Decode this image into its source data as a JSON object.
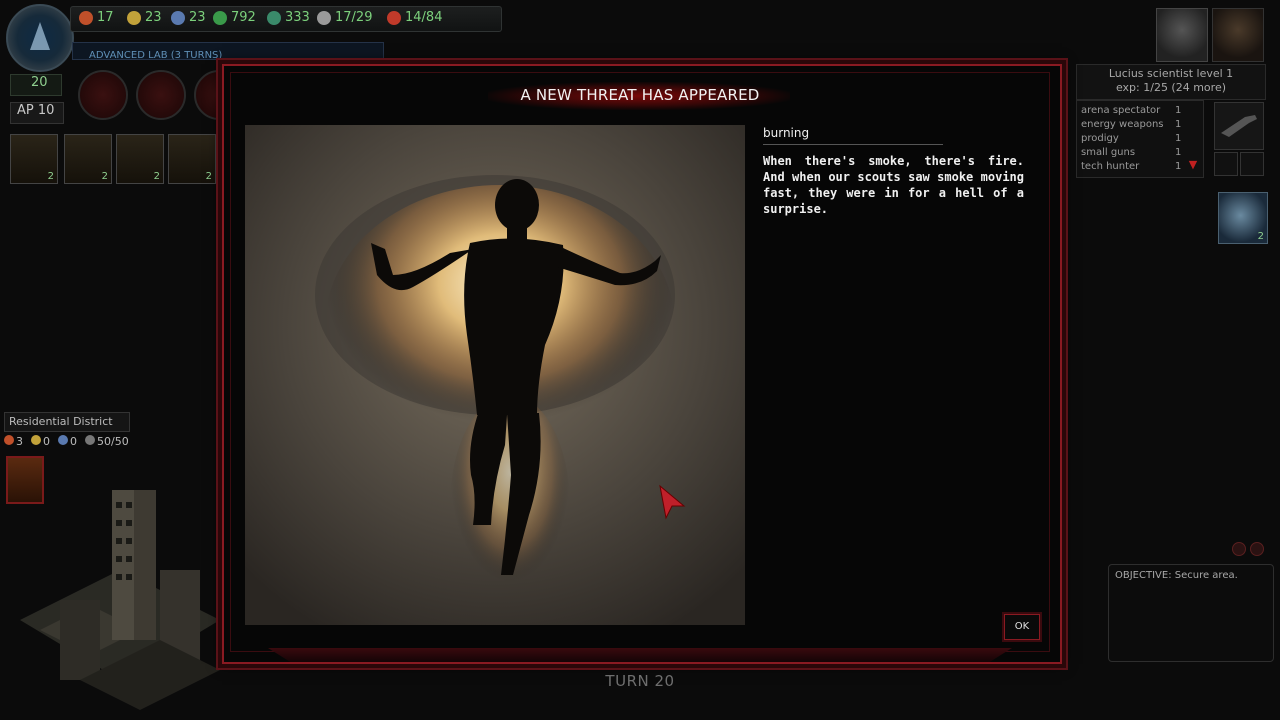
{
  "colors": {
    "accent_red": "#8a1a22",
    "resource_green": "#7cd07c",
    "lab_blue": "#5f8fb6"
  },
  "resources": [
    {
      "icon": "flame-icon",
      "value": "17",
      "color": "#c0502a"
    },
    {
      "icon": "coin-icon",
      "value": "23",
      "color": "#c2a23a"
    },
    {
      "icon": "energy-icon",
      "value": "23",
      "color": "#5a7ab0"
    },
    {
      "icon": "money-icon",
      "value": "792",
      "color": "#3a9a4a"
    },
    {
      "icon": "influence-icon",
      "value": "333",
      "color": "#3a8a6a"
    },
    {
      "icon": "radiation-icon",
      "value": "17/29",
      "color": "#9a9a9a"
    },
    {
      "icon": "unit-icon",
      "value": "14/84",
      "color": "#c03a2a"
    }
  ],
  "lab_status": "ADVANCED LAB (3 TURNS)",
  "turns_counter": "20",
  "ap": "AP 10",
  "unit_slots": [
    {
      "count": "2"
    },
    {
      "count": "2"
    },
    {
      "count": "2"
    },
    {
      "count": "2"
    }
  ],
  "district": {
    "name": "Residential District",
    "stats": [
      {
        "icon": "flame-icon",
        "value": "3",
        "color": "#c0502a"
      },
      {
        "icon": "coin-icon",
        "value": "0",
        "color": "#c2a23a"
      },
      {
        "icon": "energy-icon",
        "value": "0",
        "color": "#5a7ab0"
      },
      {
        "icon": "shield-icon",
        "value": "50/50",
        "color": "#777777"
      }
    ]
  },
  "character": {
    "line1": "Lucius   scientist   level 1",
    "line2": "exp: 1/25   (24 more)",
    "skills": [
      {
        "name": "arena spectator",
        "level": "1"
      },
      {
        "name": "energy weapons",
        "level": "1"
      },
      {
        "name": "prodigy",
        "level": "1"
      },
      {
        "name": "small guns",
        "level": "1"
      },
      {
        "name": "tech hunter",
        "level": "1"
      }
    ],
    "side_unit_count": "2"
  },
  "objective": "OBJECTIVE: Secure area.",
  "modal": {
    "title": "A NEW THREAT HAS APPEARED",
    "threat_name": "burning",
    "description": "When there's smoke, there's fire. And when our scouts saw smoke moving fast, they were in for a hell of a surprise.",
    "ok_label": "OK"
  },
  "turn": "TURN 20"
}
